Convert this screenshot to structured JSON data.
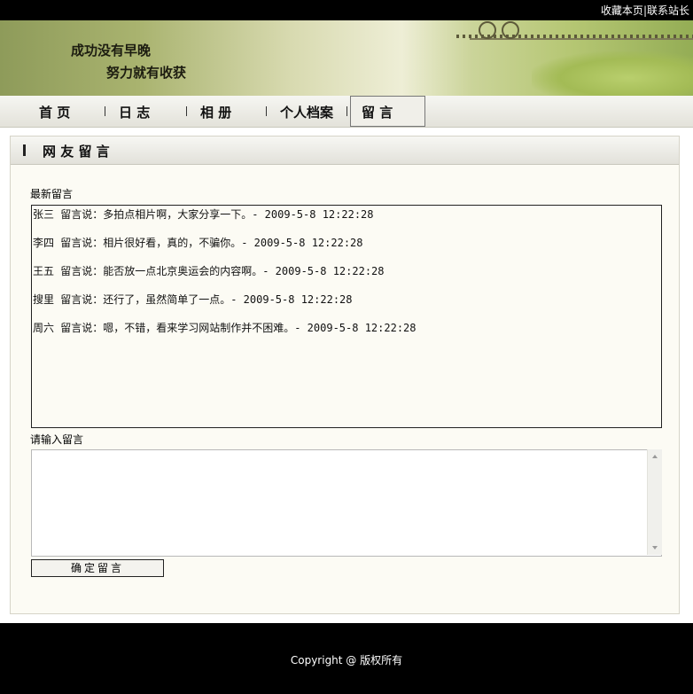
{
  "topbar": {
    "bookmark_label": "收藏本页",
    "separator": "|",
    "contact_label": "联系站长"
  },
  "banner": {
    "slogan_line1": "成功没有早晚",
    "slogan_line2": "努力就有收获"
  },
  "nav": {
    "items": [
      {
        "label": "首  页"
      },
      {
        "label": "日  志"
      },
      {
        "label": "相  册"
      },
      {
        "label": "个人档案"
      },
      {
        "label": "留  言",
        "active": true
      }
    ]
  },
  "panel": {
    "title": "网 友 留 言",
    "latest_label": "最新留言",
    "messages": [
      {
        "text": "张三 留言说：多拍点相片啊，大家分享一下。- 2009-5-8 12:22:28"
      },
      {
        "text": "李四 留言说：相片很好看，真的，不骗你。- 2009-5-8 12:22:28"
      },
      {
        "text": "王五 留言说：能否放一点北京奥运会的内容啊。- 2009-5-8 12:22:28"
      },
      {
        "text": "搜里 留言说：还行了，虽然简单了一点。- 2009-5-8 12:22:28"
      },
      {
        "text": "周六 留言说：嗯，不错，看来学习网站制作并不困难。- 2009-5-8 12:22:28"
      }
    ],
    "input_label": "请输入留言",
    "input_value": "",
    "submit_label": "确定留言"
  },
  "footer": {
    "copyright": "Copyright @ 版权所有"
  },
  "colors": {
    "topbar_bg": "#000000",
    "footer_bg": "#000000",
    "panel_bg": "#fcfbf4",
    "banner_green": "#a9b36f"
  }
}
